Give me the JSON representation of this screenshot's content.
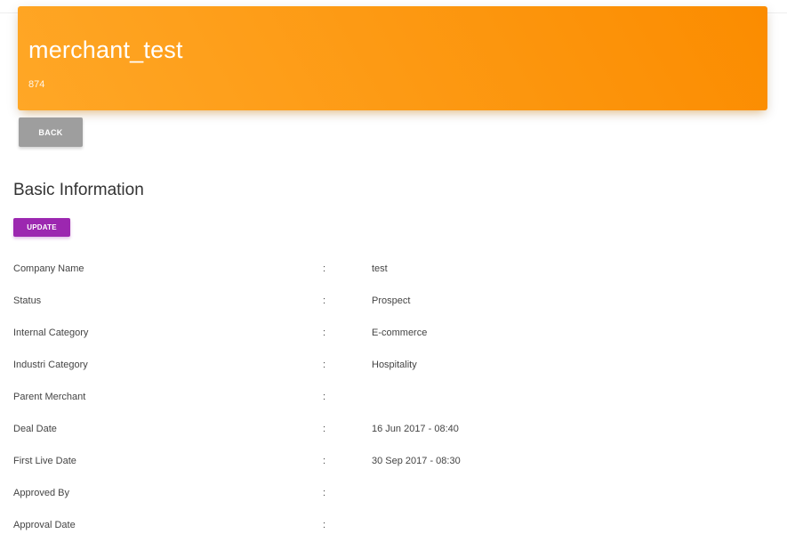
{
  "header": {
    "title": "merchant_test",
    "subtitle": "874"
  },
  "actions": {
    "back_label": "BACK",
    "update_label": "UPDATE"
  },
  "section": {
    "title": "Basic Information"
  },
  "fields": [
    {
      "label": "Company Name",
      "separator": ":",
      "value": "test"
    },
    {
      "label": "Status",
      "separator": ":",
      "value": "Prospect"
    },
    {
      "label": "Internal Category",
      "separator": ":",
      "value": "E-commerce"
    },
    {
      "label": "Industri Category",
      "separator": ":",
      "value": "Hospitality"
    },
    {
      "label": "Parent Merchant",
      "separator": ":",
      "value": ""
    },
    {
      "label": "Deal Date",
      "separator": ":",
      "value": "16 Jun 2017 - 08:40"
    },
    {
      "label": "First Live Date",
      "separator": ":",
      "value": "30 Sep 2017 - 08:30"
    },
    {
      "label": "Approved By",
      "separator": ":",
      "value": ""
    },
    {
      "label": "Approval Date",
      "separator": ":",
      "value": ""
    }
  ],
  "colors": {
    "header_gradient_start": "#ffa726",
    "header_gradient_end": "#fb8c00",
    "back_button": "#9e9e9e",
    "update_button": "#9c27b0"
  }
}
